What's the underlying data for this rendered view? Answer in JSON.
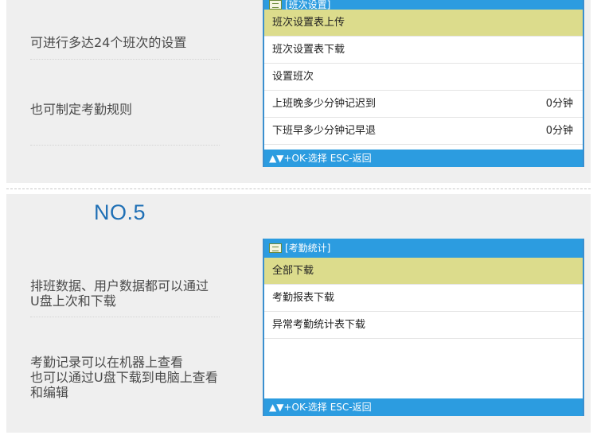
{
  "section1": {
    "desc_a": "可进行多达24个班次的设置",
    "desc_b": "也可制定考勤规则",
    "screen": {
      "title": "[班次设置]",
      "items": [
        {
          "label": "班次设置表上传",
          "value": ""
        },
        {
          "label": "班次设置表下载",
          "value": ""
        },
        {
          "label": "设置班次",
          "value": ""
        },
        {
          "label": "上班晚多少分钟记迟到",
          "value": "0分钟"
        },
        {
          "label": "下班早多少分钟记早退",
          "value": "0分钟"
        }
      ],
      "footer": "▲▼+OK-选择 ESC-返回"
    }
  },
  "section2": {
    "heading": "NO.5",
    "desc_a": "排班数据、用户数据都可以通过\nU盘上次和下载",
    "desc_b": "考勤记录可以在机器上查看\n也可以通过U盘下载到电脑上查看\n和编辑",
    "screen": {
      "title": "[考勤统计]",
      "items": [
        {
          "label": "全部下载"
        },
        {
          "label": "考勤报表下载"
        },
        {
          "label": "异常考勤统计表下载"
        }
      ],
      "footer": "▲▼+OK-选择 ESC-返回"
    }
  },
  "colors": {
    "accent": "#2c9ce0",
    "selected_row": "#dcdc8c",
    "heading": "#1e6fb5"
  }
}
